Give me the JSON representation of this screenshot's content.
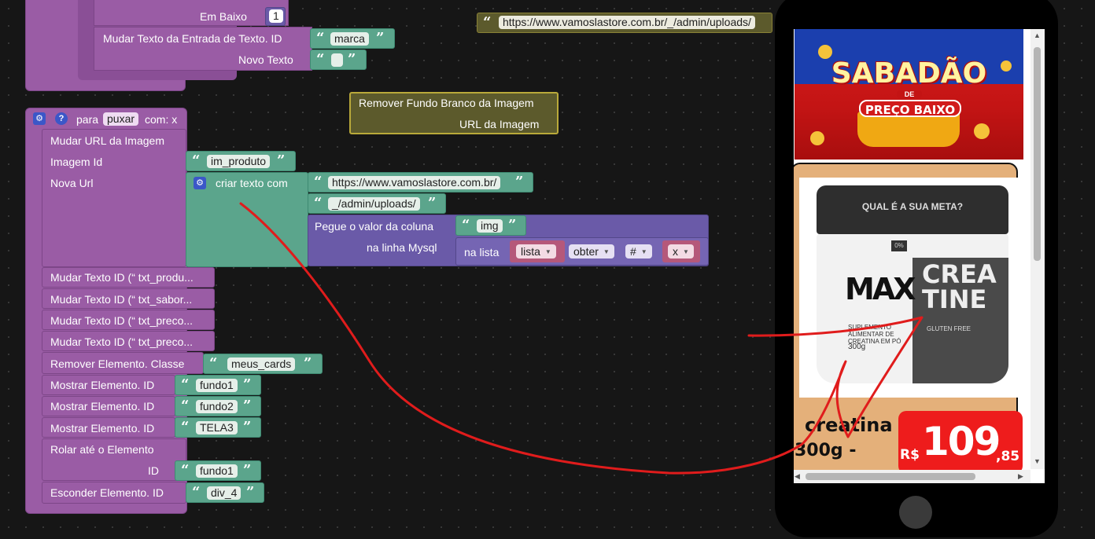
{
  "top_stack": {
    "em_baixo_label": "Em Baixo",
    "em_baixo_value": "1",
    "set_text_label": "Mudar Texto da Entrada de Texto. ID",
    "set_text_id": "marca",
    "new_text_label": "Novo Texto",
    "new_text_value": ""
  },
  "url_block": {
    "value": "https://www.vamoslastore.com.br/_/admin/uploads/"
  },
  "remove_bg_block": {
    "title": "Remover Fundo Branco da Imagem",
    "param": "URL da Imagem"
  },
  "procedure": {
    "para": "para",
    "name": "puxar",
    "params": "com: x",
    "set_image_url": "Mudar URL da Imagem",
    "image_id_label": "Imagem Id",
    "image_id": "im_produto",
    "new_url_label": "Nova Url",
    "join_label": "criar texto com",
    "join_part1": "https://www.vamoslastore.com.br/",
    "join_part2": "_/admin/uploads/",
    "get_col_label": "Pegue o valor da coluna",
    "col_name": "img",
    "row_label": "na linha Mysql",
    "in_list": "na lista",
    "list_var": "lista",
    "get_op": "obter",
    "hash": "#",
    "index_var": "x",
    "set_text_1": "Mudar Texto ID (“ txt_produ...",
    "set_text_2": "Mudar Texto ID (“ txt_sabor...",
    "set_text_3": "Mudar Texto ID (“ txt_preco...",
    "set_text_4": "Mudar Texto ID (“ txt_preco...",
    "remove_class_label": "Remover Elemento. Classe",
    "remove_class_value": "meus_cards",
    "show_label": "Mostrar Elemento. ID",
    "show_1": "fundo1",
    "show_2": "fundo2",
    "show_3": "TELA3",
    "scroll_label": "Rolar até o Elemento",
    "scroll_id_label": "ID",
    "scroll_id": "fundo1",
    "hide_label": "Esconder Elemento. ID",
    "hide_id": "div_4"
  },
  "phone": {
    "banner_line1": "SABADÃO",
    "banner_de": "DE",
    "banner_line2": "PREÇO BAIXO",
    "product_tagline": "QUAL É A SUA META?",
    "jar_brand": "MAX",
    "jar_line1": "CREA",
    "jar_line2": "TINE",
    "jar_sub": "SUPLEMENTO ALIMENTAR DE CREATINA EM PÓ",
    "jar_weight": "300g",
    "jar_badge": "0%",
    "jar_gluten": "GLUTEN FREE",
    "product_name_1": "creatina",
    "product_name_2": "300g -",
    "currency": "R$",
    "price_int": "109",
    "price_cents": ",85"
  },
  "colors": {
    "procedure": "#9a5ca5",
    "text": "#5ba58c",
    "mysql": "#6a5aa8",
    "price_tag": "#ee1c1c",
    "card_bg": "#e4b07a"
  }
}
